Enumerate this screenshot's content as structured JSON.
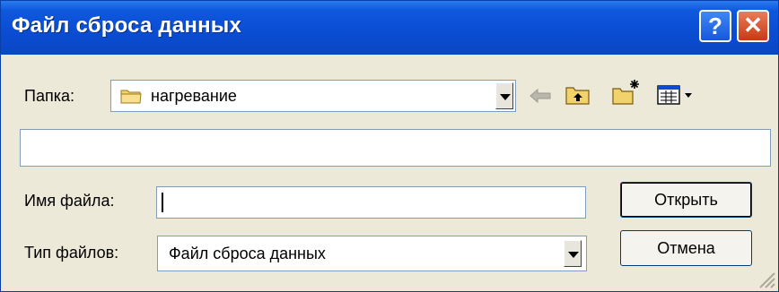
{
  "dialog": {
    "title": "Файл сброса данных",
    "help_label": "?",
    "close_label": "✕"
  },
  "folder": {
    "label": "Папка:",
    "value": "нагревание"
  },
  "file_name": {
    "label": "Имя файла:",
    "value": ""
  },
  "file_type": {
    "label": "Тип файлов:",
    "value": "Файл сброса данных"
  },
  "buttons": {
    "open": "Открыть",
    "cancel": "Отмена"
  },
  "toolbar_icons": [
    "back-arrow-icon",
    "up-folder-icon",
    "new-folder-icon",
    "view-menu-icon"
  ],
  "colors": {
    "titlebar": "#0a4cd2",
    "dialog_bg": "#ece9d8",
    "close_button": "#c83a14",
    "input_border": "#7f9db9"
  }
}
